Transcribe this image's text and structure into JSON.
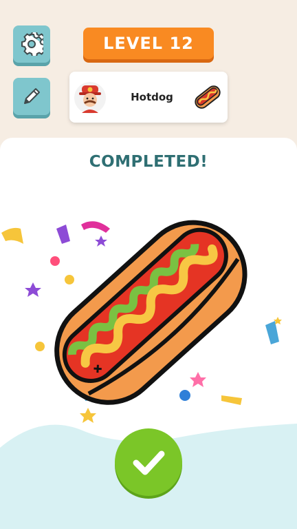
{
  "header": {
    "level_label": "LEVEL 12"
  },
  "target": {
    "name": "Hotdog"
  },
  "result": {
    "title": "COMPLETED!"
  },
  "icons": {
    "settings": "gear-icon",
    "edit": "pencil-icon",
    "confirm": "checkmark-icon"
  },
  "colors": {
    "accent_orange": "#f98a22",
    "teal_button": "#7fc6cd",
    "title_teal": "#2f6f73",
    "confirm_green": "#7bc628"
  }
}
